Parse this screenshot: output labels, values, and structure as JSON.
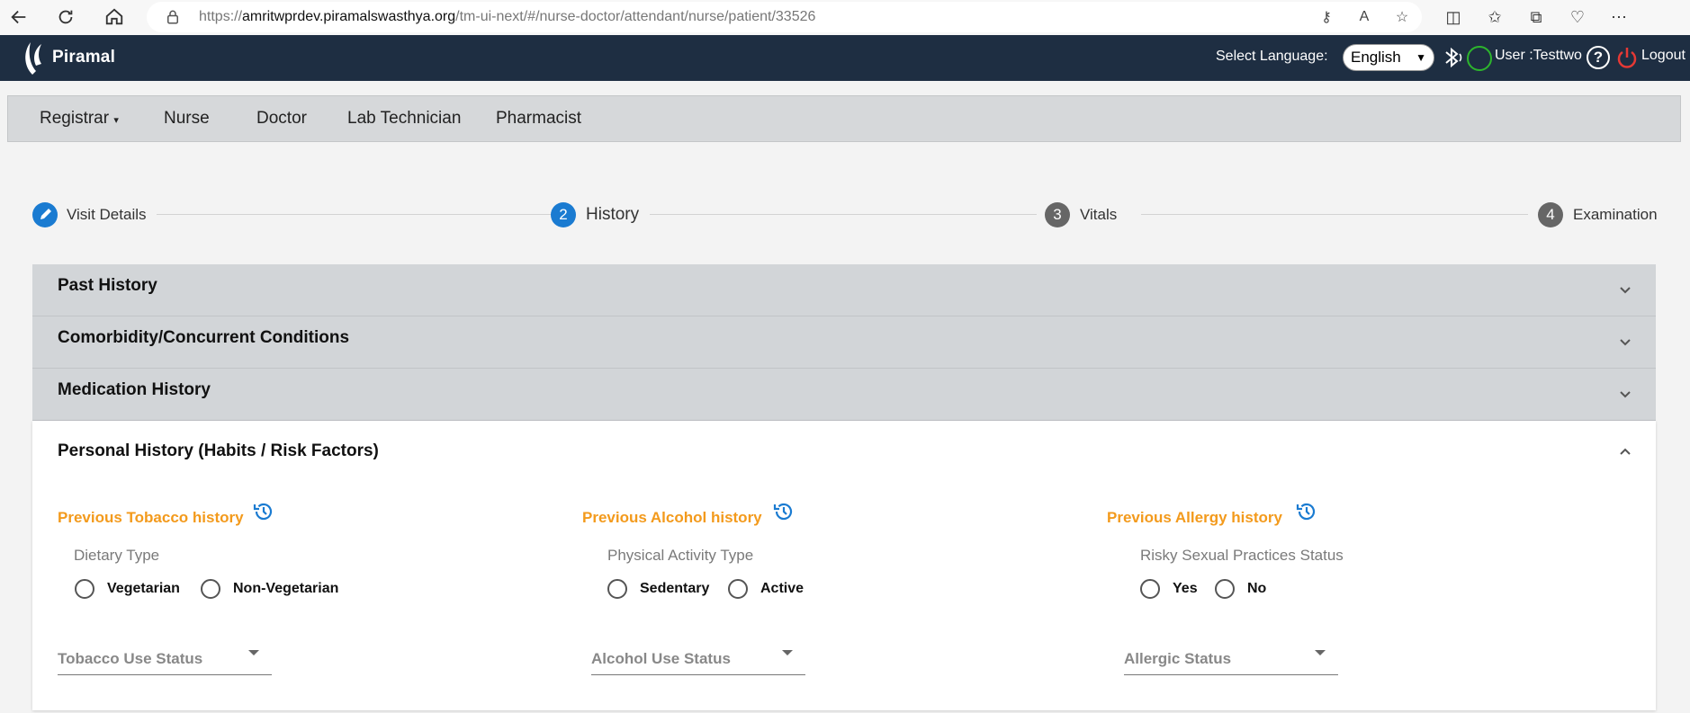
{
  "browser": {
    "url_prefix": "https://",
    "url_domain": "amritwprdev.piramalswasthya.org",
    "url_path": "/tm-ui-next/#/nurse-doctor/attendant/nurse/patient/33526"
  },
  "header": {
    "brand": "Piramal",
    "language_label": "Select Language:",
    "language_value": "English",
    "user_label": "User :Testtwo",
    "logout_label": "Logout"
  },
  "roles": [
    {
      "label": "Registrar"
    },
    {
      "label": "Nurse"
    },
    {
      "label": "Doctor"
    },
    {
      "label": "Lab Technician"
    },
    {
      "label": "Pharmacist"
    }
  ],
  "stepper": [
    {
      "num": "",
      "label": "Visit Details"
    },
    {
      "num": "2",
      "label": "History"
    },
    {
      "num": "3",
      "label": "Vitals"
    },
    {
      "num": "4",
      "label": "Examination"
    }
  ],
  "accordion": {
    "past_history": "Past History",
    "comorbidity": "Comorbidity/Concurrent Conditions",
    "medication": "Medication History",
    "personal": "Personal History (Habits / Risk Factors)"
  },
  "personal": {
    "tobacco": {
      "prev_label": "Previous Tobacco history",
      "field_label": "Dietary Type",
      "options": [
        "Vegetarian",
        "Non-Vegetarian"
      ],
      "select_placeholder": "Tobacco Use Status"
    },
    "alcohol": {
      "prev_label": "Previous Alcohol history",
      "field_label": "Physical Activity Type",
      "options": [
        "Sedentary",
        "Active"
      ],
      "select_placeholder": "Alcohol Use Status"
    },
    "allergy": {
      "prev_label": "Previous Allergy history",
      "field_label": "Risky Sexual Practices Status",
      "options": [
        "Yes",
        "No"
      ],
      "select_placeholder": "Allergic Status"
    }
  },
  "colors": {
    "header_bg": "#1e2e42",
    "step_active": "#1a7bd1",
    "step_inactive": "#666666",
    "prev_link": "#f39a1c",
    "history_icon": "#1a7bd1"
  }
}
